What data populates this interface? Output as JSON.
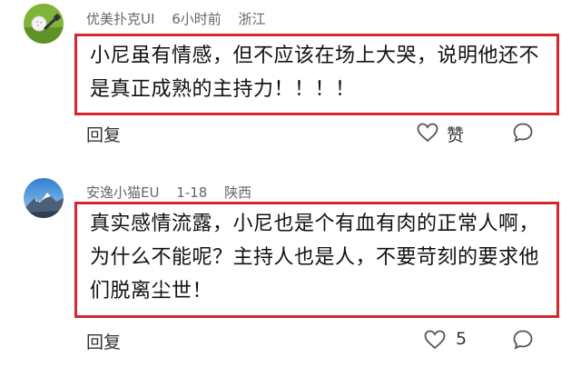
{
  "comments": [
    {
      "username": "优美扑克UI",
      "time": "6小时前",
      "location": "浙江",
      "text": "小尼虽有情感，但不应该在场上大哭，说明他还不是真正成熟的主持力！！！！",
      "reply_label": "回复",
      "like_label": "赞",
      "icons": [
        "avatar-golf",
        "heart-icon",
        "comment-icon"
      ]
    },
    {
      "username": "安逸小猫EU",
      "time": "1-18",
      "location": "陕西",
      "text": "真实感情流露，小尼也是个有血有肉的正常人啊，为什么不能呢？主持人也是人，不要苛刻的要求他们脱离尘世！",
      "reply_label": "回复",
      "like_count": "5",
      "icons": [
        "avatar-mountain",
        "heart-icon",
        "comment-icon"
      ]
    }
  ],
  "colors": {
    "highlight_border": "#d6262b",
    "meta_text": "#666666"
  }
}
